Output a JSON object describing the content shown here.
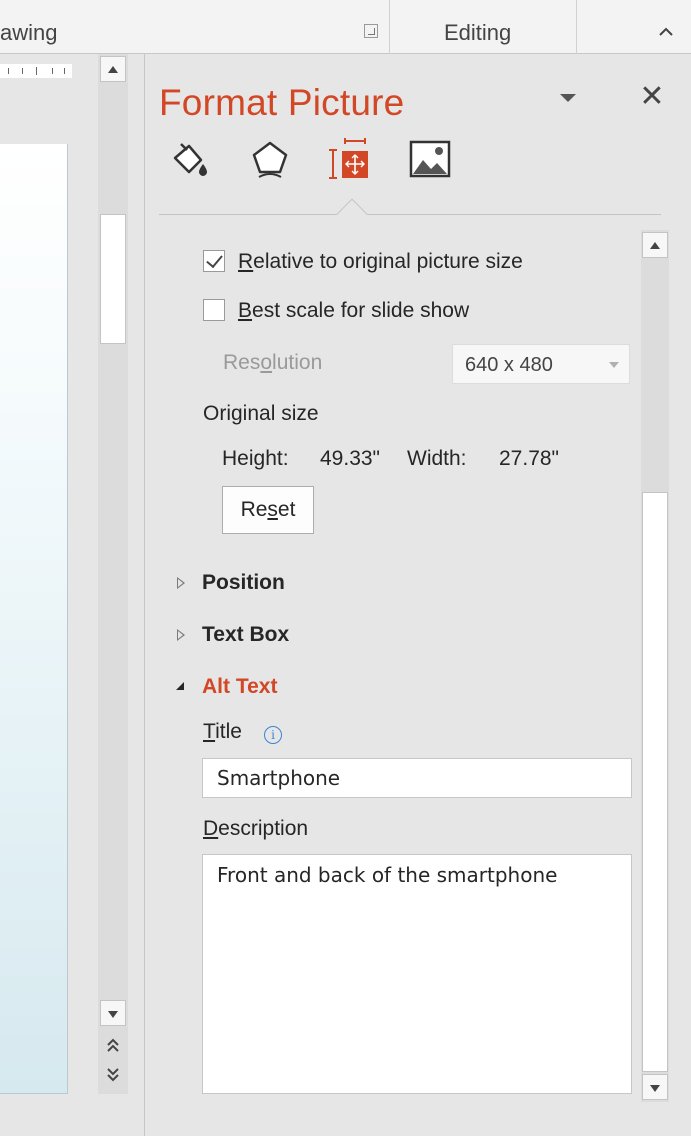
{
  "ribbon": {
    "drawing_group": "awing",
    "editing_group": "Editing"
  },
  "pane": {
    "title": "Format Picture",
    "close_glyph": "✕",
    "tabs": [
      {
        "name": "Fill & Line",
        "icon": "paint-bucket-icon"
      },
      {
        "name": "Effects",
        "icon": "pentagon-icon"
      },
      {
        "name": "Size & Properties",
        "icon": "size-properties-icon",
        "active": true
      },
      {
        "name": "Picture",
        "icon": "picture-icon"
      }
    ],
    "relative_size": {
      "label_u": "R",
      "label_rest": "elative to original picture size",
      "checked": true
    },
    "best_scale": {
      "label_u": "B",
      "label_rest": "est scale for slide show",
      "checked": false
    },
    "resolution": {
      "label_pre": "Res",
      "label_u": "o",
      "label_post": "lution",
      "value": "640 x 480"
    },
    "original_size": {
      "label": "Original size",
      "height_label": "Height:",
      "height_value": "49.33\"",
      "width_label": "Width:",
      "width_value": "27.78\""
    },
    "reset": {
      "pre": "Re",
      "u": "s",
      "post": "et"
    },
    "sections": {
      "position": "Position",
      "text_box": "Text Box",
      "alt_text": "Alt Text"
    },
    "alt_text": {
      "title_u": "T",
      "title_rest": "itle",
      "title_value": "Smartphone",
      "description_u": "D",
      "description_rest": "escription",
      "description_value": "Front and back of the smartphone"
    }
  },
  "colors": {
    "accent": "#d24726",
    "pane_bg": "#e6e6e6",
    "info_blue": "#3c84d4"
  }
}
